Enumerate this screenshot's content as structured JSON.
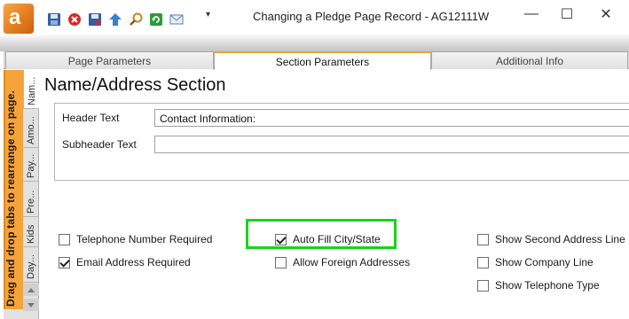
{
  "window": {
    "title": "Changing a Pledge Page Record - AG12111W",
    "qat_more": "▾",
    "minimize": "—",
    "maximize": "☐",
    "close": "✕",
    "logo_letter": "a"
  },
  "quick_access": [
    "save-icon",
    "cancel-icon",
    "save-close-icon",
    "up-arrow-icon",
    "search-icon",
    "refresh-icon",
    "mail-icon"
  ],
  "tabs": [
    {
      "label": "Page Parameters"
    },
    {
      "label": "Section Parameters"
    },
    {
      "label": "Additional Info"
    }
  ],
  "left_panel": {
    "drag_hint": "Drag and drop tabs to rearrange on page.",
    "vtabs": [
      "Nam...",
      "Amo...",
      "Pay...",
      "Pre...",
      "Kids",
      "Day..."
    ]
  },
  "section": {
    "title": "Name/Address Section",
    "header_text_label": "Header Text",
    "header_text_value": "Contact Information:",
    "subheader_text_label": "Subheader Text",
    "subheader_text_value": ""
  },
  "checkboxes": {
    "telephone_required": {
      "label": "Telephone Number Required",
      "checked": false
    },
    "email_required": {
      "label": "Email Address Required",
      "checked": true
    },
    "auto_fill": {
      "label": "Auto Fill City/State",
      "checked": true
    },
    "foreign_addresses": {
      "label": "Allow Foreign Addresses",
      "checked": false
    },
    "second_address": {
      "label": "Show Second Address Line",
      "checked": false
    },
    "company_line": {
      "label": "Show Company Line",
      "checked": false
    },
    "telephone_type": {
      "label": "Show Telephone Type",
      "checked": false
    }
  },
  "colors": {
    "accent_orange": "#f5a33a",
    "highlight_green": "#19d319"
  }
}
